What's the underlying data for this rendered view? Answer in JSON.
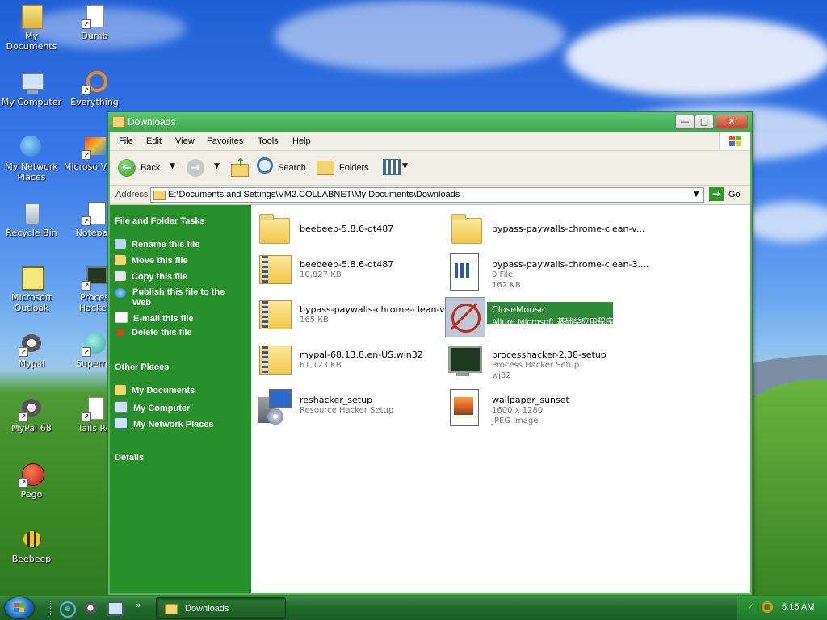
{
  "desktop": {
    "icons": [
      {
        "label": "My Documents",
        "icon": "my-documents-icon"
      },
      {
        "label": "Dumb",
        "icon": "shortcut-icon"
      },
      {
        "label": "My Computer",
        "icon": "my-computer-icon"
      },
      {
        "label": "Everything",
        "icon": "everything-icon"
      },
      {
        "label": "My Network Places",
        "icon": "network-places-icon"
      },
      {
        "label": "Microso Visual Stu",
        "icon": "visual-studio-icon"
      },
      {
        "label": "Recycle Bin",
        "icon": "recycle-bin-icon"
      },
      {
        "label": "Notepad",
        "icon": "notepad-icon"
      },
      {
        "label": "Microsoft Outlook",
        "icon": "outlook-icon"
      },
      {
        "label": "Proces Hacker",
        "icon": "process-hacker-icon"
      },
      {
        "label": "Mypal",
        "icon": "mypal-icon"
      },
      {
        "label": "Supermi",
        "icon": "supermium-icon"
      },
      {
        "label": "MyPal 68",
        "icon": "mypal-icon"
      },
      {
        "label": "Tails Re",
        "icon": "shortcut-icon"
      },
      {
        "label": "Pego",
        "icon": "pego-icon"
      },
      {
        "label": "Beebeep",
        "icon": "beebeep-icon"
      }
    ]
  },
  "window": {
    "title": "Downloads",
    "menu": [
      "File",
      "Edit",
      "View",
      "Favorites",
      "Tools",
      "Help"
    ],
    "toolbar": {
      "back": "Back",
      "search": "Search",
      "folders": "Folders"
    },
    "address": {
      "label": "Address",
      "value": "E:\\Documents and Settings\\VM2.COLLABNET\\My Documents\\Downloads",
      "go": "Go"
    },
    "tasks_pane": {
      "file_tasks_title": "File and Folder Tasks",
      "file_tasks": [
        "Rename this file",
        "Move this file",
        "Copy this file",
        "Publish this file to the Web",
        "E-mail this file",
        "Delete this file"
      ],
      "other_places_title": "Other Places",
      "other_places": [
        "My Documents",
        "My Computer",
        "My Network Places"
      ],
      "details_title": "Details"
    },
    "files": [
      {
        "name": "beebeep-5.8.6-qt487",
        "line2": "",
        "line3": "",
        "kind": "folder"
      },
      {
        "name": "bypass-paywalls-chrome-clean-v...",
        "line2": "",
        "line3": "",
        "kind": "folder"
      },
      {
        "name": "beebeep-5.8.6-qt487",
        "line2": "10,827 KB",
        "line3": "",
        "kind": "zip"
      },
      {
        "name": "bypass-paywalls-chrome-clean-3....",
        "line2": "0 File",
        "line3": "162 KB",
        "kind": "file"
      },
      {
        "name": "bypass-paywalls-chrome-clean-v...",
        "line2": "165 KB",
        "line3": "",
        "kind": "zip"
      },
      {
        "name": "CloseMouse",
        "line2": "Allure Microsoft 基础类应用程序",
        "line3": "",
        "kind": "app",
        "selected": true
      },
      {
        "name": "mypal-68.13.8.en-US.win32",
        "line2": "61,123 KB",
        "line3": "",
        "kind": "zip"
      },
      {
        "name": "processhacker-2.38-setup",
        "line2": "Process Hacker Setup",
        "line3": "wj32",
        "kind": "setup"
      },
      {
        "name": "reshacker_setup",
        "line2": "Resource Hacker Setup",
        "line3": "",
        "kind": "installer"
      },
      {
        "name": "wallpaper_sunset",
        "line2": "1600 x 1280",
        "line3": "JPEG Image",
        "kind": "image"
      }
    ]
  },
  "taskbar": {
    "task_label": "Downloads",
    "clock": "5:15 AM"
  },
  "colors": {
    "task_pane": "#27902b",
    "titlebar": "#4bb35e",
    "selection": "#2e8a38"
  }
}
